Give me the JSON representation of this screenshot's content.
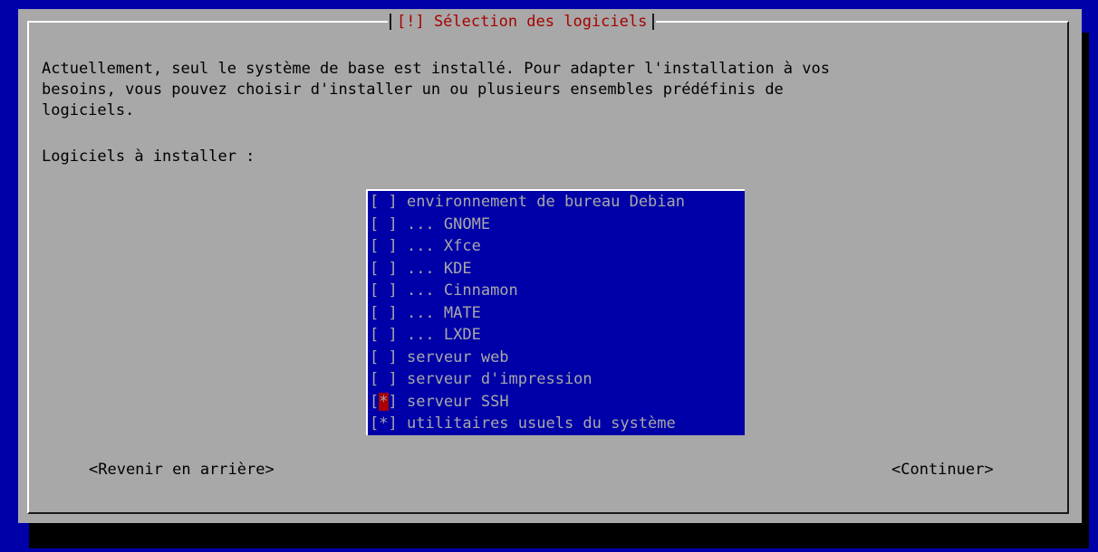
{
  "dialog": {
    "title": "[!] Sélection des logiciels",
    "intro": "Actuellement, seul le système de base est installé. Pour adapter l'installation à vos\nbesoins, vous pouvez choisir d'installer un ou plusieurs ensembles prédéfinis de\nlogiciels.",
    "prompt": "Logiciels à installer :"
  },
  "list": {
    "items": [
      {
        "box": "[ ]",
        "label": " environnement de bureau Debian",
        "checked": false
      },
      {
        "box": "[ ]",
        "label": " ... GNOME",
        "checked": false
      },
      {
        "box": "[ ]",
        "label": " ... Xfce",
        "checked": false
      },
      {
        "box": "[ ]",
        "label": " ... KDE",
        "checked": false
      },
      {
        "box": "[ ]",
        "label": " ... Cinnamon",
        "checked": false
      },
      {
        "box": "[ ]",
        "label": " ... MATE",
        "checked": false
      },
      {
        "box": "[ ]",
        "label": " ... LXDE",
        "checked": false
      },
      {
        "box": "[ ]",
        "label": " serveur web",
        "checked": false
      },
      {
        "box": "[ ]",
        "label": " serveur d'impression",
        "checked": false
      },
      {
        "box_left": "[",
        "box_mark": "*",
        "box_right": "]",
        "label": " serveur SSH",
        "checked": true,
        "focused": true
      },
      {
        "box": "[*]",
        "label": " utilitaires usuels du système",
        "checked": true
      }
    ]
  },
  "buttons": {
    "back": "<Revenir en arrière>",
    "continue": "<Continuer>"
  },
  "colors": {
    "background": "#0000a8",
    "dialog": "#a8a8a8",
    "title": "#a80000",
    "list_bg": "#0000a8",
    "list_text": "#a8a8a8",
    "focus_mark": "#a80000"
  }
}
